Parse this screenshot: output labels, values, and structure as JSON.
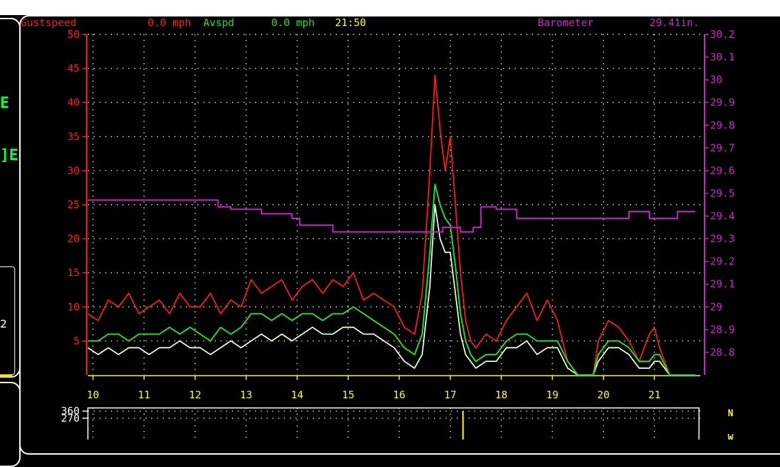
{
  "window": {
    "title": ""
  },
  "header": {
    "gust_label": "Gustspeed",
    "gust_value": "0.0 mph",
    "avg_label": "Avspd",
    "avg_value": "0.0 mph",
    "time": "21:50",
    "baro_label": "Barometer",
    "baro_value": "29.41in."
  },
  "side": {
    "reading": "2"
  },
  "colors": {
    "gust": "#ff1a1a",
    "avg": "#22dd22",
    "speed": "#e8ffe0",
    "baro": "#cc22cc",
    "time": "#ffff00",
    "axis_x": "#ffff00"
  },
  "chart_data": {
    "type": "line",
    "x_unit": "hour",
    "xlim": [
      9.9,
      21.9
    ],
    "x_ticks": [
      10,
      11,
      12,
      13,
      14,
      15,
      16,
      17,
      18,
      19,
      20,
      21
    ],
    "y_left": {
      "ylim": [
        0,
        50
      ],
      "ticks": [
        5,
        10,
        15,
        20,
        25,
        30,
        35,
        40,
        45,
        50
      ],
      "unit": "mph"
    },
    "y_right": {
      "ylim": [
        28.7,
        30.2
      ],
      "ticks": [
        28.8,
        28.9,
        29.0,
        29.1,
        29.2,
        29.3,
        29.4,
        29.5,
        29.6,
        29.7,
        29.8,
        29.9,
        30.0,
        30.1,
        30.2
      ],
      "tick_labels": [
        "28.8",
        "28.9",
        "29",
        "29.1",
        "29.2",
        "29.3",
        "29.4",
        "29.5",
        "29.6",
        "29.7",
        "29.8",
        "29.9",
        "30",
        "30.1",
        "30.2"
      ],
      "unit": "in"
    },
    "grid": true,
    "series": [
      {
        "name": "Gustspeed",
        "axis": "left",
        "x": [
          9.9,
          10.1,
          10.3,
          10.5,
          10.7,
          10.9,
          11.1,
          11.3,
          11.5,
          11.7,
          11.9,
          12.1,
          12.3,
          12.5,
          12.7,
          12.9,
          13.1,
          13.3,
          13.5,
          13.7,
          13.9,
          14.1,
          14.3,
          14.5,
          14.7,
          14.9,
          15.1,
          15.3,
          15.5,
          15.7,
          15.9,
          16.1,
          16.3,
          16.45,
          16.6,
          16.7,
          16.8,
          16.9,
          17.0,
          17.1,
          17.2,
          17.3,
          17.4,
          17.5,
          17.7,
          17.9,
          18.1,
          18.3,
          18.5,
          18.7,
          18.9,
          19.1,
          19.3,
          19.5,
          19.7,
          19.8,
          19.9,
          20.1,
          20.3,
          20.5,
          20.7,
          20.9,
          21.0,
          21.1,
          21.3,
          21.5,
          21.7,
          21.8
        ],
        "values": [
          9,
          8,
          11,
          10,
          12,
          9,
          10,
          11,
          9,
          12,
          10,
          10,
          12,
          9,
          11,
          10,
          14,
          12,
          13,
          14,
          11,
          13,
          14,
          12,
          14,
          13,
          15,
          11,
          12,
          11,
          10,
          7,
          6,
          12,
          30,
          44,
          36,
          30,
          35,
          25,
          15,
          8,
          5,
          4,
          6,
          5,
          8,
          10,
          12,
          8,
          11,
          8,
          2,
          0,
          0,
          0,
          5,
          8,
          7,
          5,
          2,
          6,
          7,
          4,
          0,
          0,
          0,
          0
        ]
      },
      {
        "name": "Avspd",
        "axis": "left",
        "x": [
          9.9,
          10.1,
          10.3,
          10.5,
          10.7,
          10.9,
          11.1,
          11.3,
          11.5,
          11.7,
          11.9,
          12.1,
          12.3,
          12.5,
          12.7,
          12.9,
          13.1,
          13.3,
          13.5,
          13.7,
          13.9,
          14.1,
          14.3,
          14.5,
          14.7,
          14.9,
          15.1,
          15.3,
          15.5,
          15.7,
          15.9,
          16.1,
          16.3,
          16.45,
          16.6,
          16.7,
          16.8,
          16.9,
          17.0,
          17.1,
          17.2,
          17.3,
          17.4,
          17.5,
          17.7,
          17.9,
          18.1,
          18.3,
          18.5,
          18.7,
          18.9,
          19.1,
          19.3,
          19.5,
          19.7,
          19.8,
          19.9,
          20.1,
          20.3,
          20.5,
          20.7,
          20.9,
          21.0,
          21.1,
          21.3,
          21.5,
          21.7,
          21.8
        ],
        "values": [
          5,
          5,
          6,
          6,
          5,
          6,
          6,
          6,
          7,
          6,
          7,
          6,
          5,
          7,
          6,
          7,
          9,
          9,
          8,
          9,
          8,
          9,
          9,
          8,
          9,
          9,
          10,
          9,
          8,
          7,
          6,
          4,
          3,
          6,
          18,
          28,
          25,
          23,
          22,
          16,
          9,
          5,
          3,
          2,
          3,
          3,
          5,
          6,
          6,
          5,
          5,
          5,
          2,
          0,
          0,
          0,
          3,
          5,
          5,
          4,
          2,
          2,
          3,
          3,
          0,
          0,
          0,
          0
        ]
      },
      {
        "name": "",
        "axis": "left",
        "x": [
          9.9,
          10.1,
          10.3,
          10.5,
          10.7,
          10.9,
          11.1,
          11.3,
          11.5,
          11.7,
          11.9,
          12.1,
          12.3,
          12.5,
          12.7,
          12.9,
          13.1,
          13.3,
          13.5,
          13.7,
          13.9,
          14.1,
          14.3,
          14.5,
          14.7,
          14.9,
          15.1,
          15.3,
          15.5,
          15.7,
          15.9,
          16.1,
          16.3,
          16.45,
          16.6,
          16.7,
          16.8,
          16.9,
          17.0,
          17.1,
          17.2,
          17.3,
          17.4,
          17.5,
          17.7,
          17.9,
          18.1,
          18.3,
          18.5,
          18.7,
          18.9,
          19.1,
          19.3,
          19.5,
          19.7,
          19.8,
          19.9,
          20.1,
          20.3,
          20.5,
          20.7,
          20.9,
          21.0,
          21.1,
          21.3,
          21.5,
          21.7,
          21.8
        ],
        "values": [
          4,
          3,
          4,
          3,
          4,
          4,
          3,
          4,
          4,
          5,
          4,
          4,
          3,
          4,
          5,
          4,
          5,
          6,
          5,
          6,
          5,
          6,
          7,
          6,
          6,
          7,
          7,
          6,
          6,
          5,
          4,
          2,
          1,
          3,
          13,
          25,
          20,
          18,
          18,
          12,
          6,
          3,
          2,
          1,
          2,
          2,
          4,
          4,
          5,
          3,
          4,
          4,
          1,
          0,
          0,
          0,
          2,
          4,
          4,
          3,
          1,
          1,
          2,
          2,
          0,
          0,
          0,
          0
        ]
      },
      {
        "name": "Barometer",
        "axis": "right",
        "step": true,
        "x": [
          9.9,
          11.95,
          12.45,
          12.7,
          13.3,
          13.9,
          14.05,
          14.7,
          15.3,
          15.45,
          16.4,
          16.85,
          17.2,
          17.45,
          17.6,
          17.9,
          18.3,
          19.5,
          20.0,
          20.5,
          20.9,
          21.45,
          21.8
        ],
        "values": [
          29.47,
          29.47,
          29.44,
          29.43,
          29.41,
          29.39,
          29.36,
          29.33,
          29.33,
          29.33,
          29.33,
          29.35,
          29.33,
          29.35,
          29.44,
          29.43,
          29.39,
          29.39,
          29.39,
          29.42,
          29.39,
          29.42,
          29.42
        ]
      }
    ],
    "direction": {
      "ylim": [
        0,
        360
      ],
      "ticks": [
        270,
        360
      ],
      "labels": [
        "N",
        "W"
      ],
      "x": [
        17.25
      ],
      "values": [
        360
      ]
    }
  }
}
